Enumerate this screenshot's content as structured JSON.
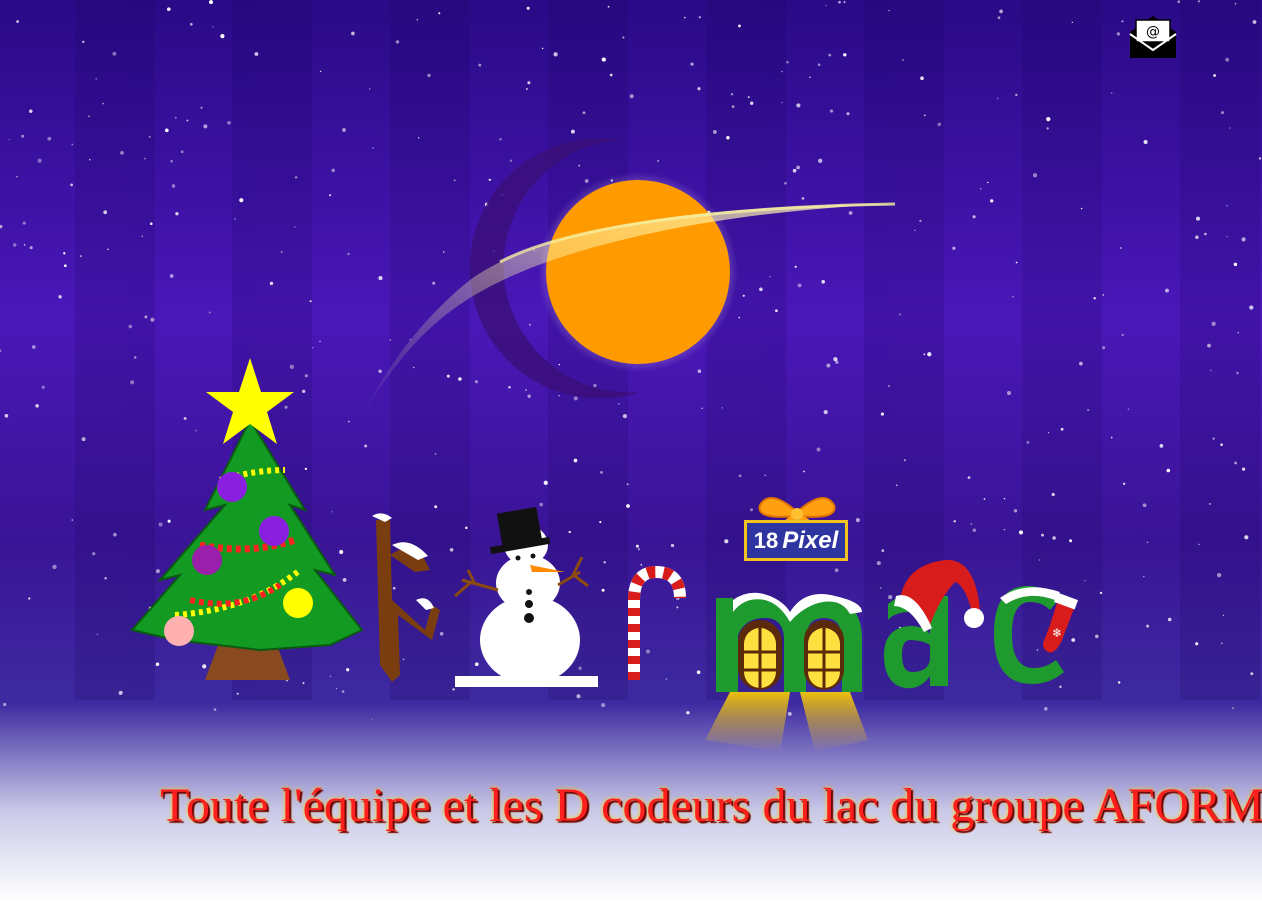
{
  "page": {
    "marquee_text": "Toute l'équipe et les D codeurs du lac du groupe AFORMAC",
    "badge_number": "18",
    "badge_label": "Pixel"
  },
  "icons": {
    "mail": "mail-envelope-icon",
    "tree": "christmas-tree-icon",
    "snowman": "snowman-icon",
    "candy_cane": "candy-cane-icon",
    "gift": "gift-bow-icon",
    "santa_hat": "santa-hat-icon",
    "stocking": "christmas-stocking-icon",
    "moon": "moon-icon",
    "comet": "shooting-star-icon"
  },
  "colors": {
    "sky_top": "#2c0b8e",
    "sky_mid": "#5a1fc8",
    "ground": "#ffffff",
    "sun": "#ff9a00",
    "letters": "#1e9a2e",
    "text": "#ff1f1f",
    "badge_bg": "#2f35a0",
    "badge_border": "#f4c21f"
  }
}
